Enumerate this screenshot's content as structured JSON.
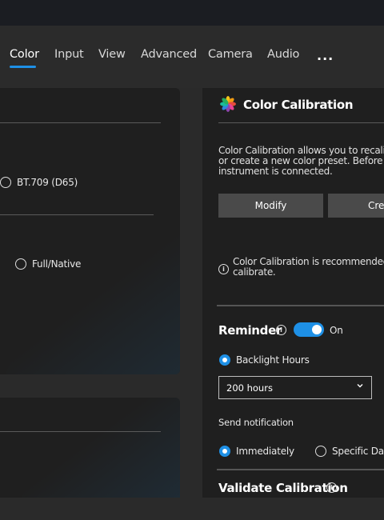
{
  "tabs": [
    {
      "label": "Color",
      "active": true
    },
    {
      "label": "Input"
    },
    {
      "label": "View"
    },
    {
      "label": "Advanced"
    },
    {
      "label": "Camera"
    },
    {
      "label": "Audio"
    }
  ],
  "more_label": "...",
  "left_panel": {
    "options": [
      {
        "label": "BT.709 (D65)",
        "selected": false
      },
      {
        "label": "Full/Native",
        "selected": false
      }
    ]
  },
  "calibration": {
    "title": "Color Calibration",
    "icon": "color-wheel-icon",
    "desc_lines": [
      "Color Calibration allows you to recalibr",
      "or create a new color preset. Before be",
      "instrument is connected."
    ],
    "modify_label": "Modify",
    "create_label": "Crea",
    "note_lines": [
      "Color Calibration is recommended. P",
      "calibrate."
    ]
  },
  "reminder": {
    "title": "Reminder",
    "toggle_state": "On",
    "backlight_label": "Backlight Hours",
    "hours_value": "200 hours",
    "send_notification_label": "Send notification",
    "immediately_label": "Immediately",
    "specific_day_label": "Specific Day"
  },
  "validate": {
    "title": "Validate Calibration"
  },
  "colors": {
    "accent": "#1e90e6",
    "panel": "#1f1f1f",
    "background": "#2a2a2a"
  }
}
